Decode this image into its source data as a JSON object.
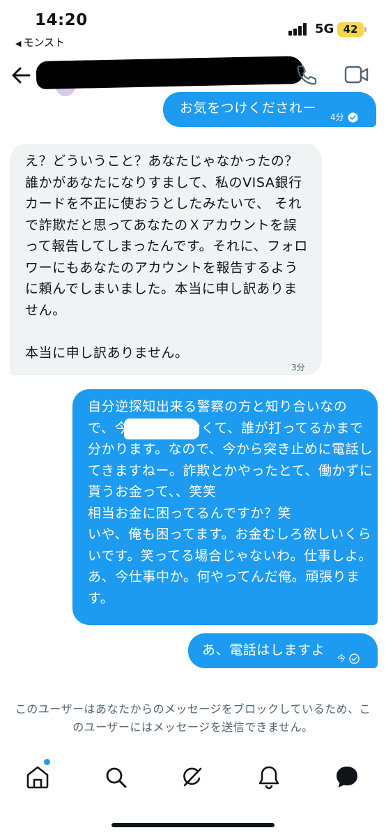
{
  "status_bar": {
    "time": "14:20",
    "back_app": "モンスト",
    "network": "5G",
    "battery": "42"
  },
  "header": {
    "back_icon": "back-arrow-icon",
    "phone_icon": "phone-icon",
    "video_icon": "video-camera-icon"
  },
  "messages": [
    {
      "direction": "sent",
      "text": "お気をつけくだされー",
      "time": "4分",
      "status_icon": "read-check-icon"
    },
    {
      "direction": "received",
      "text": "え？どういうこと？あなたじゃなかったの？誰かがあなたになりすまして、私のVISA銀行カードを不正に使おうとしたみたいで、 それで詐欺だと思ってあなたのＸアカウントを誤って報告してしまったんです。それに、フォロワーにもあなたのアカウントを報告するように頼んでしまいました。本当に申し訳ありません。\n\n本当に申し訳ありません。",
      "time": "3分"
    },
    {
      "direction": "sent",
      "text": "自分逆探知出来る警察の方と知り合いなので、今 さんじゃなくて、誰が打ってるかまで分かります。なので、今から突き止めに電話してきますねー。詐欺とかやったとて、働かずに貰うお金って、、笑笑\n相当お金に困ってるんですか？笑\nいや、俺も困ってます。お金むしろ欲しいくらいです。笑ってる場合じゃないわ。仕事しよ。あ、今仕事中か。何やってんだ俺。頑張ります。"
    },
    {
      "direction": "sent",
      "text": "あ、電話はしますよ",
      "time": "今",
      "status_icon": "sent-check-icon"
    }
  ],
  "blocked_notice": "このユーザーはあなたからのメッセージをブロックしているため、このユーザーにはメッセージを送信できません。",
  "bottom_nav": {
    "items": [
      "home-icon",
      "search-icon",
      "grok-icon",
      "notifications-bell-icon",
      "messages-icon"
    ],
    "notification_dot_color": "#1d9bf0"
  },
  "colors": {
    "accent": "#1d9bf0",
    "received_bubble": "#eff3f4",
    "secondary_text": "#536471"
  }
}
